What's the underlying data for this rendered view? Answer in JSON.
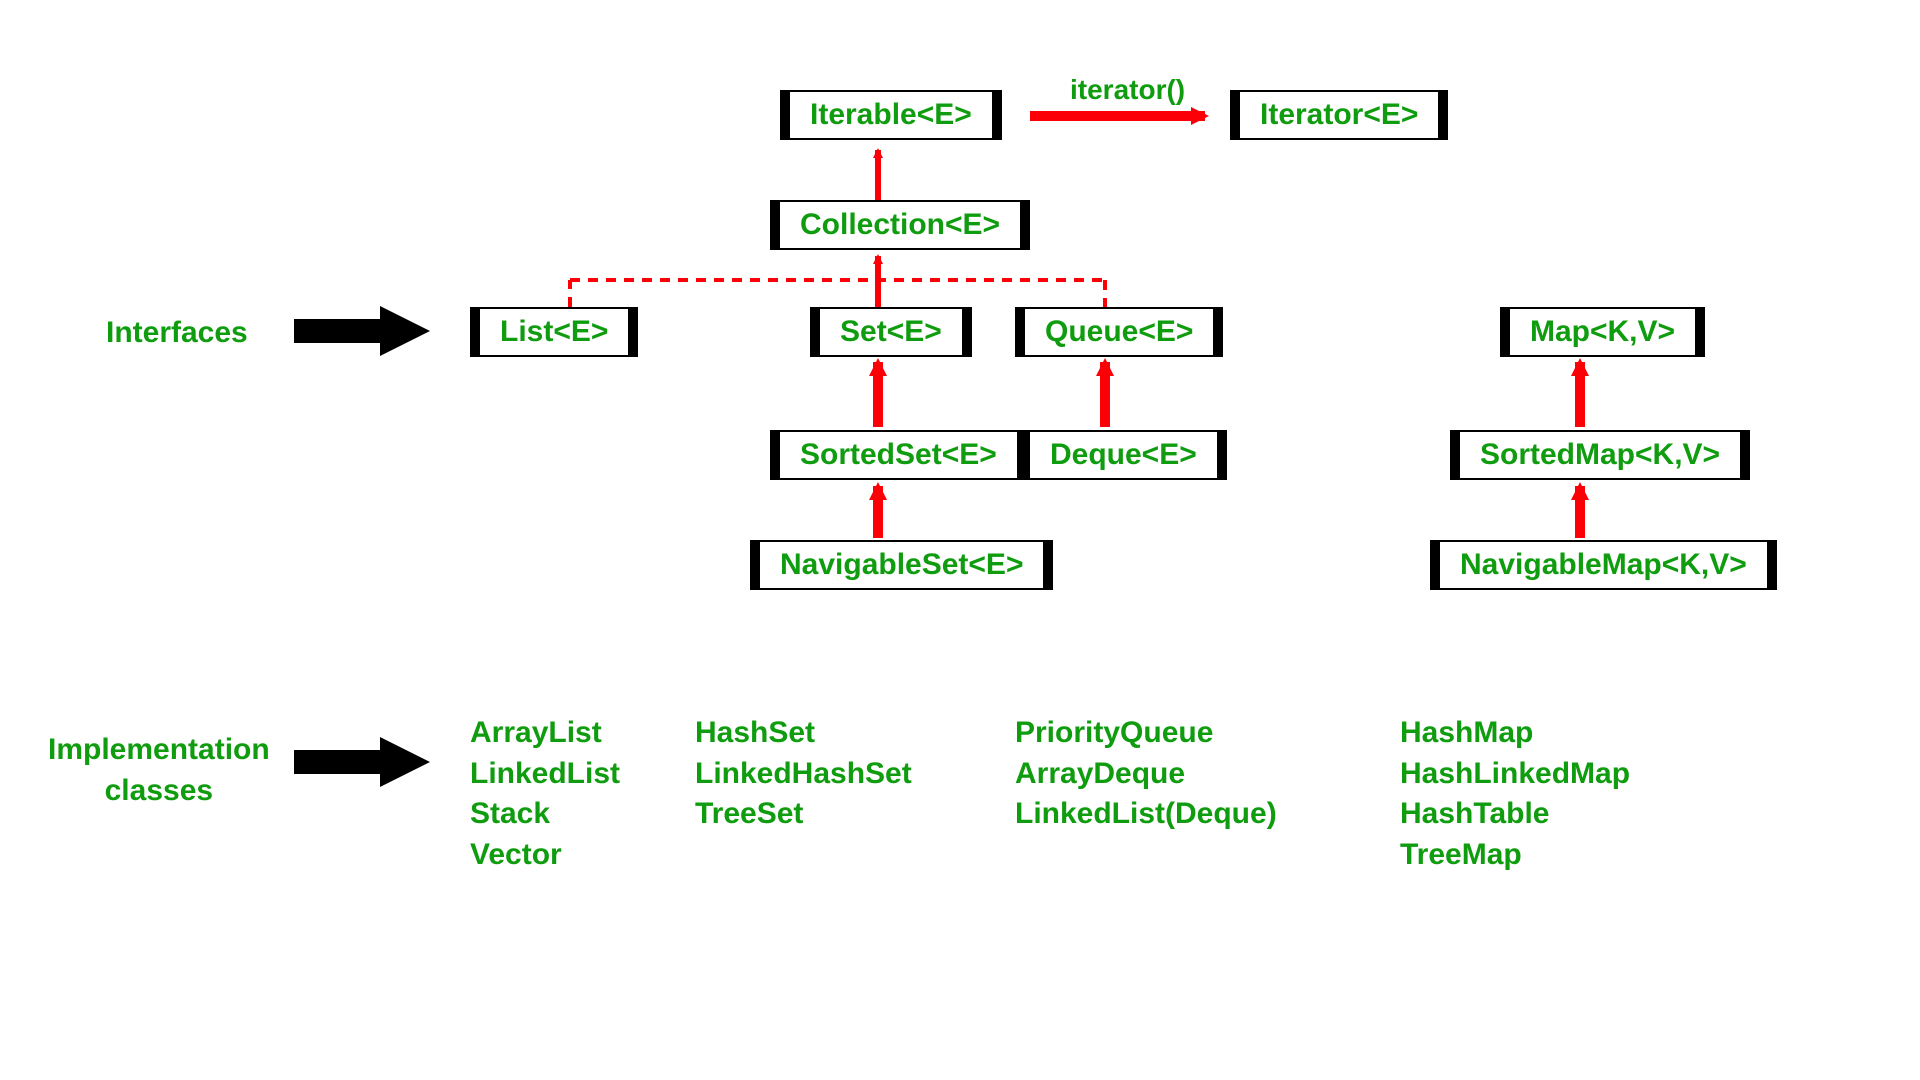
{
  "nodes": {
    "iterable": "Iterable<E>",
    "iterator": "Iterator<E>",
    "collection": "Collection<E>",
    "list": "List<E>",
    "set": "Set<E>",
    "queue": "Queue<E>",
    "sortedset": "SortedSet<E>",
    "navigableset": "NavigableSet<E>",
    "deque": "Deque<E>",
    "map": "Map<K,V>",
    "sortedmap": "SortedMap<K,V>",
    "navigablemap": "NavigableMap<K,V>"
  },
  "labels": {
    "iterator_method": "iterator()",
    "interfaces": "Interfaces",
    "implementation_classes": "Implementation\nclasses"
  },
  "implementations": {
    "list_impl": "ArrayList\nLinkedList\nStack\nVector",
    "set_impl": "HashSet\nLinkedHashSet\nTreeSet",
    "queue_impl": "PriorityQueue\nArrayDeque\nLinkedList(Deque)",
    "map_impl": "HashMap\nHashLinkedMap\nHashTable\nTreeMap"
  },
  "colors": {
    "text_green": "#0f9c0f",
    "arrow_red": "#fb0006",
    "arrow_black": "#000000"
  }
}
